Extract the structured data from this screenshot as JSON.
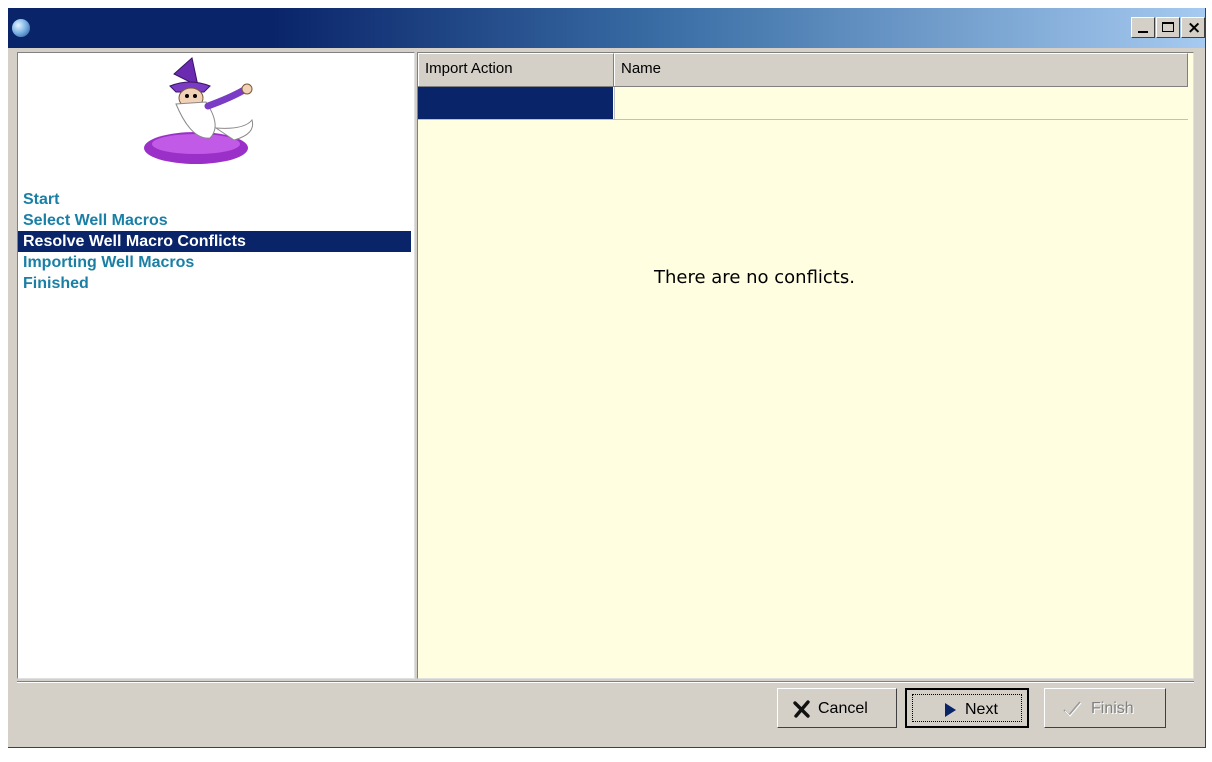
{
  "window": {
    "title": "",
    "controls": {
      "minimize": "minimize-icon",
      "maximize": "maximize-icon",
      "close": "close-icon"
    }
  },
  "wizard": {
    "steps": [
      {
        "label": "Start",
        "active": false
      },
      {
        "label": "Select Well Macros",
        "active": false
      },
      {
        "label": "Resolve Well Macro Conflicts",
        "active": true
      },
      {
        "label": "Importing Well Macros",
        "active": false
      },
      {
        "label": "Finished",
        "active": false
      }
    ]
  },
  "grid": {
    "columns": [
      "Import Action",
      "Name"
    ],
    "rows": [
      {
        "import_action": "",
        "name": ""
      }
    ],
    "empty_message": "There are no conflicts."
  },
  "buttons": {
    "cancel": "Cancel",
    "next": "Next",
    "finish": "Finish"
  },
  "colors": {
    "selection": "#0a246a",
    "step_text": "#1a7fa5",
    "grid_background": "#fffee0",
    "chrome": "#d4d0c8"
  }
}
